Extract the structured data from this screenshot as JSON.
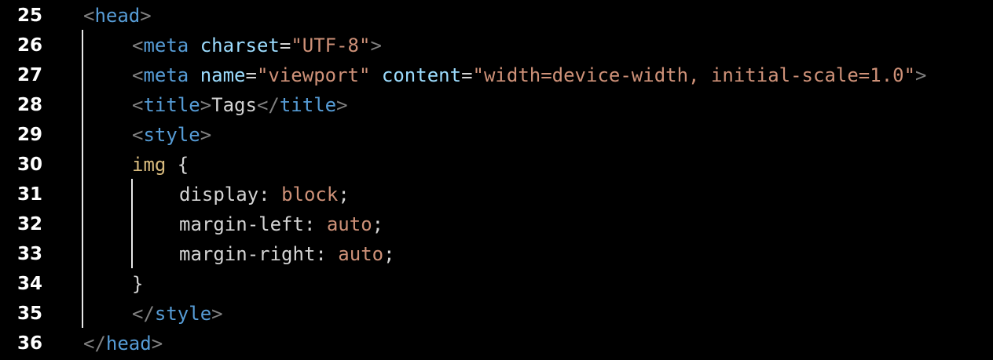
{
  "editor": {
    "lines": [
      {
        "number": "25",
        "tokens": [
          {
            "kind": "punct",
            "text": "<"
          },
          {
            "kind": "tag",
            "text": "head"
          },
          {
            "kind": "punct",
            "text": ">"
          }
        ]
      },
      {
        "number": "26",
        "tokens": [
          {
            "kind": "punct",
            "text": "<"
          },
          {
            "kind": "tag",
            "text": "meta"
          },
          {
            "kind": "txt",
            "text": " "
          },
          {
            "kind": "attr",
            "text": "charset"
          },
          {
            "kind": "txt",
            "text": "="
          },
          {
            "kind": "str",
            "text": "\"UTF-8\""
          },
          {
            "kind": "punct",
            "text": ">"
          }
        ]
      },
      {
        "number": "27",
        "tokens": [
          {
            "kind": "punct",
            "text": "<"
          },
          {
            "kind": "tag",
            "text": "meta"
          },
          {
            "kind": "txt",
            "text": " "
          },
          {
            "kind": "attr",
            "text": "name"
          },
          {
            "kind": "txt",
            "text": "="
          },
          {
            "kind": "str",
            "text": "\"viewport\""
          },
          {
            "kind": "txt",
            "text": " "
          },
          {
            "kind": "attr",
            "text": "content"
          },
          {
            "kind": "txt",
            "text": "="
          },
          {
            "kind": "str",
            "text": "\"width=device-width, initial-scale=1.0\""
          },
          {
            "kind": "punct",
            "text": ">"
          }
        ]
      },
      {
        "number": "28",
        "tokens": [
          {
            "kind": "punct",
            "text": "<"
          },
          {
            "kind": "tag",
            "text": "title"
          },
          {
            "kind": "punct",
            "text": ">"
          },
          {
            "kind": "txt",
            "text": "Tags"
          },
          {
            "kind": "punct",
            "text": "</"
          },
          {
            "kind": "tag",
            "text": "title"
          },
          {
            "kind": "punct",
            "text": ">"
          }
        ]
      },
      {
        "number": "29",
        "tokens": [
          {
            "kind": "punct",
            "text": "<"
          },
          {
            "kind": "tag",
            "text": "style"
          },
          {
            "kind": "punct",
            "text": ">"
          }
        ]
      },
      {
        "number": "30",
        "tokens": [
          {
            "kind": "sel",
            "text": "img"
          },
          {
            "kind": "txt",
            "text": " {"
          }
        ]
      },
      {
        "number": "31",
        "tokens": [
          {
            "kind": "prop",
            "text": "display"
          },
          {
            "kind": "txt",
            "text": ": "
          },
          {
            "kind": "val",
            "text": "block"
          },
          {
            "kind": "txt",
            "text": ";"
          }
        ]
      },
      {
        "number": "32",
        "tokens": [
          {
            "kind": "prop",
            "text": "margin-left"
          },
          {
            "kind": "txt",
            "text": ": "
          },
          {
            "kind": "val",
            "text": "auto"
          },
          {
            "kind": "txt",
            "text": ";"
          }
        ]
      },
      {
        "number": "33",
        "tokens": [
          {
            "kind": "prop",
            "text": "margin-right"
          },
          {
            "kind": "txt",
            "text": ": "
          },
          {
            "kind": "val",
            "text": "auto"
          },
          {
            "kind": "txt",
            "text": ";"
          }
        ]
      },
      {
        "number": "34",
        "tokens": [
          {
            "kind": "txt",
            "text": "}"
          }
        ]
      },
      {
        "number": "35",
        "tokens": [
          {
            "kind": "punct",
            "text": "</"
          },
          {
            "kind": "tag",
            "text": "style"
          },
          {
            "kind": "punct",
            "text": ">"
          }
        ]
      },
      {
        "number": "36",
        "tokens": [
          {
            "kind": "punct",
            "text": "</"
          },
          {
            "kind": "tag",
            "text": "head"
          },
          {
            "kind": "punct",
            "text": ">"
          }
        ]
      }
    ]
  },
  "colors": {
    "background": "#000000",
    "line_number": "#ffffff",
    "punctuation": "#808080",
    "tag": "#569cd6",
    "attribute": "#9cdcfe",
    "string": "#ce9178",
    "text": "#d4d4d4",
    "selector": "#d7ba7d",
    "indent_guide": "#e8e8e8"
  }
}
